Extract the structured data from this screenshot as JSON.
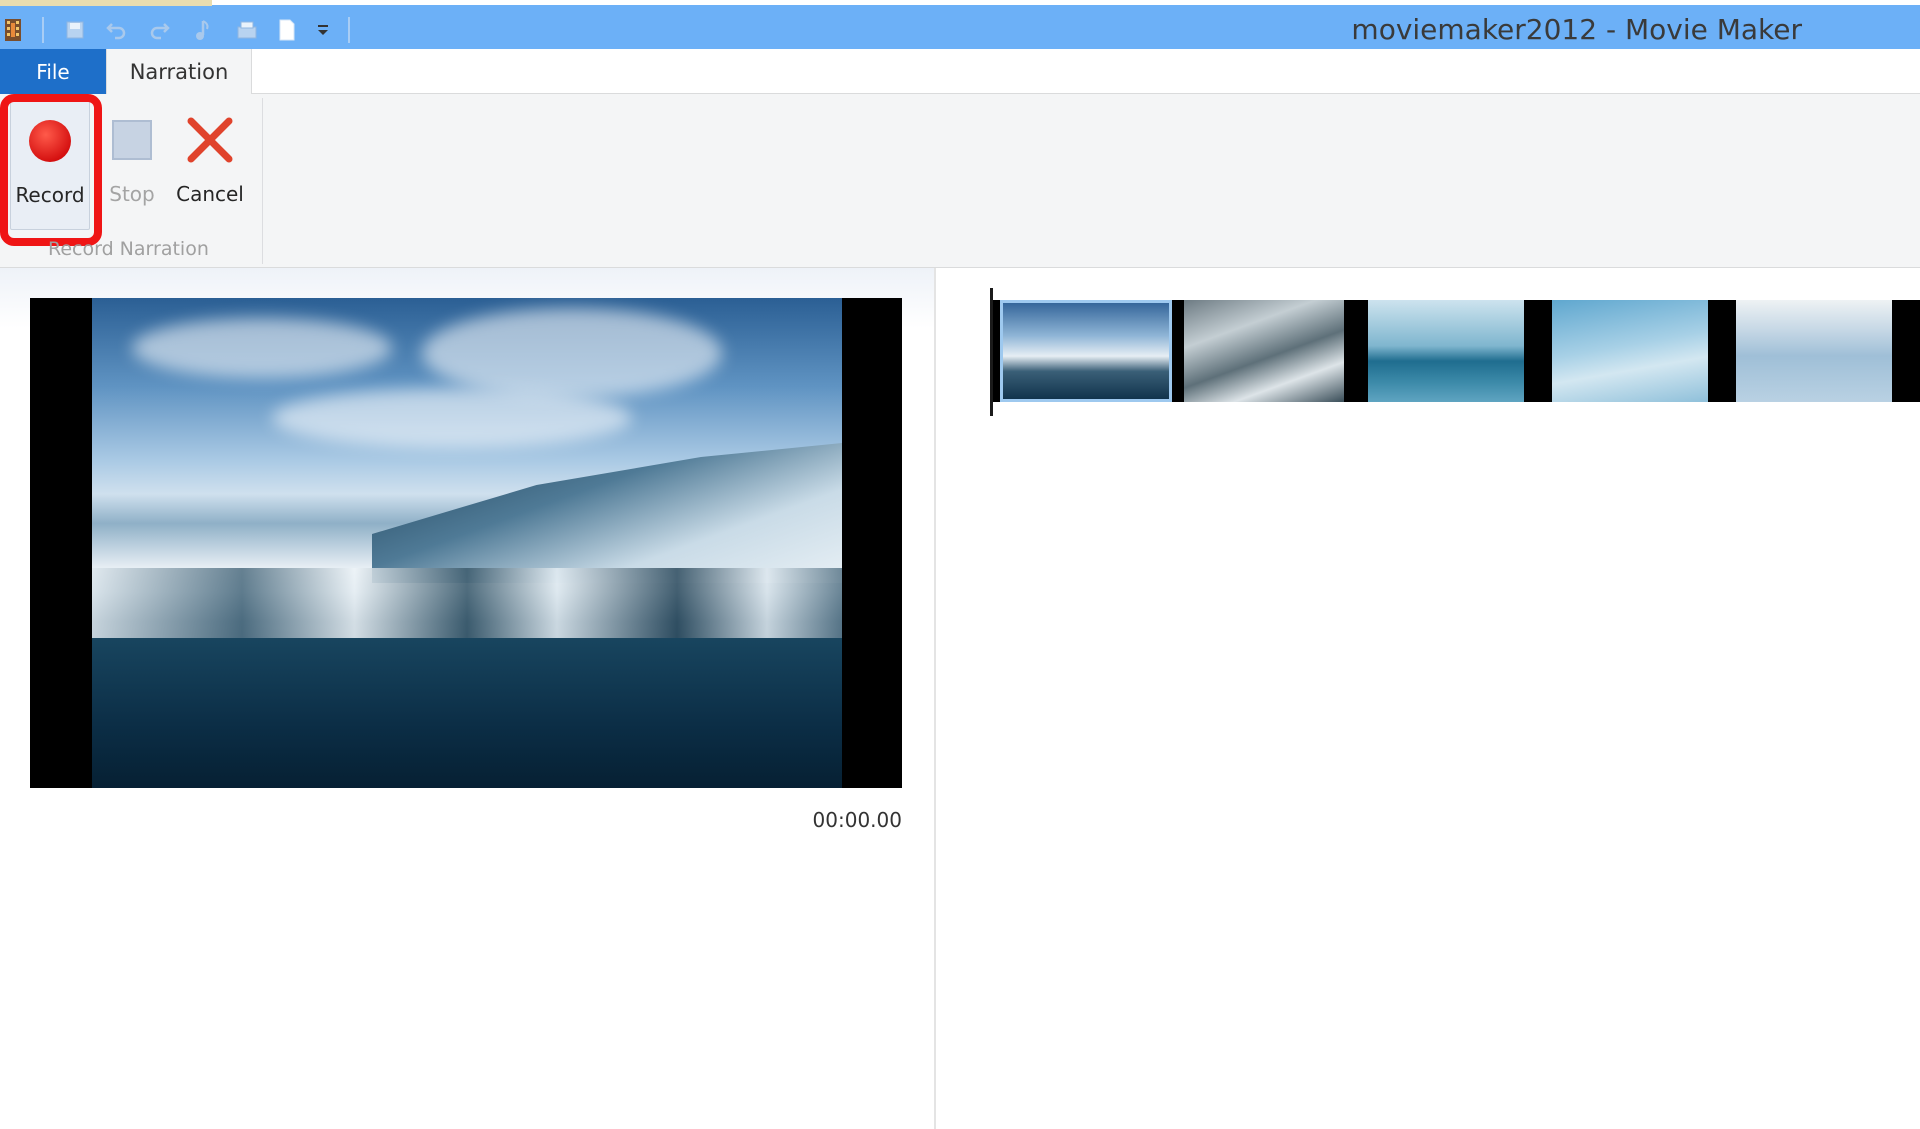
{
  "window": {
    "title": "moviemaker2012 - Movie Maker"
  },
  "quick_access": {
    "icons": [
      "app-filmstrip-icon",
      "save-icon",
      "undo-icon",
      "redo-icon",
      "music-icon",
      "snapshot-icon",
      "new-project-icon",
      "customize-dropdown-icon"
    ]
  },
  "tabs": [
    {
      "label": "File",
      "active": false
    },
    {
      "label": "Narration",
      "active": true
    }
  ],
  "ribbon": {
    "group_label": "Record Narration",
    "buttons": [
      {
        "label": "Record",
        "icon": "record-icon",
        "enabled": true,
        "highlighted": true
      },
      {
        "label": "Stop",
        "icon": "stop-icon",
        "enabled": false
      },
      {
        "label": "Cancel",
        "icon": "cancel-icon",
        "enabled": true
      }
    ]
  },
  "preview": {
    "timecode": "00:00.00"
  },
  "colors": {
    "titlebar": "#6cb0f7",
    "file_tab": "#1e6fc9",
    "record_red": "#e61e1e",
    "highlight_red": "#ef1515",
    "ribbon_bg": "#f4f5f6"
  }
}
